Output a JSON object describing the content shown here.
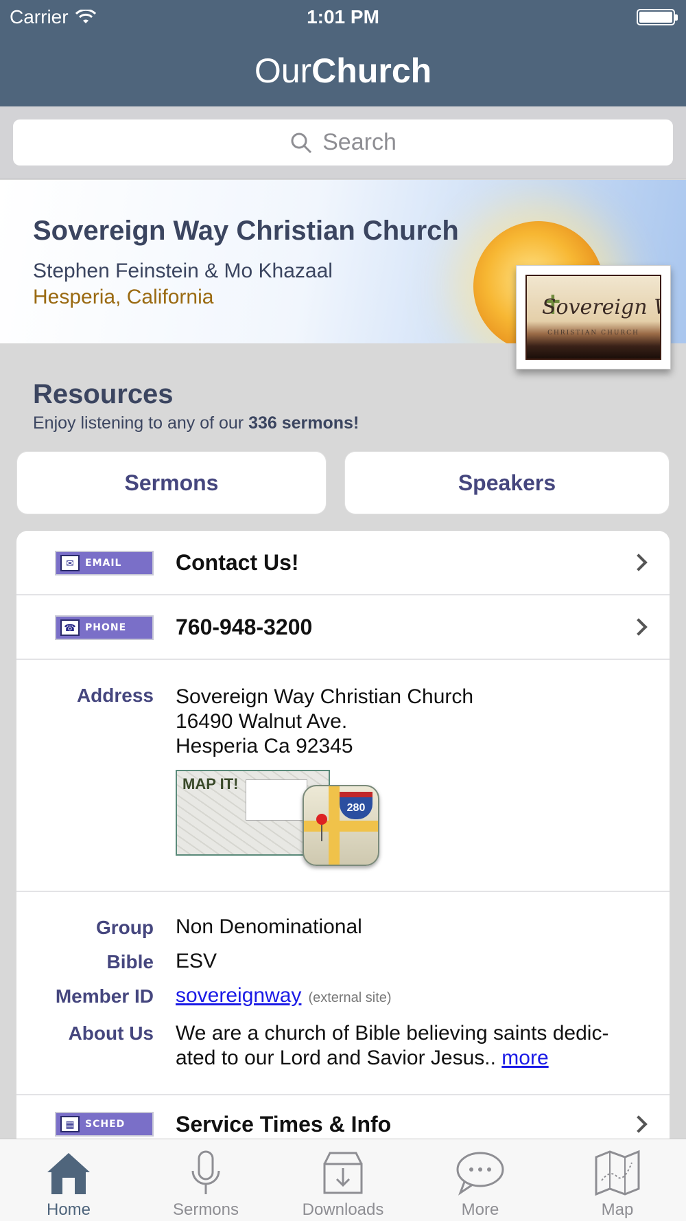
{
  "status_bar": {
    "carrier": "Carrier",
    "time": "1:01 PM"
  },
  "navbar": {
    "title_light": "Our",
    "title_bold": "Church"
  },
  "search": {
    "placeholder": "Search"
  },
  "church": {
    "name": "Sovereign Way Christian Church",
    "pastors": "Stephen Feinstein & Mo Khazaal",
    "location": "Hesperia, California",
    "logo_text": "Sovereign Way",
    "logo_subtext": "CHRISTIAN CHURCH"
  },
  "resources": {
    "title": "Resources",
    "subtitle_prefix": "Enjoy listening to any of our ",
    "subtitle_bold": "336 sermons!",
    "sermons_button": "Sermons",
    "speakers_button": "Speakers"
  },
  "contact": {
    "email_tag": "EMAIL",
    "email_label": "Contact Us!",
    "phone_tag": "PHONE",
    "phone_number": "760-948-3200"
  },
  "address": {
    "label": "Address",
    "line1": "Sovereign Way Christian Church",
    "line2": "16490 Walnut Ave.",
    "line3": "Hesperia Ca 92345",
    "map_it": "MAP IT!",
    "shield_number": "280"
  },
  "details": {
    "group_label": "Group",
    "group_value": "Non Denominational",
    "bible_label": "Bible",
    "bible_value": "ESV",
    "member_label": "Member ID",
    "member_value": "sovereignway",
    "member_external": "(external site)",
    "about_label": "About Us",
    "about_line1": "We are a church of Bible believing saints dedic-",
    "about_line2": "ated to our Lord and Savior Jesus.. ",
    "about_more": "more"
  },
  "sched": {
    "tag": "SCHED",
    "label": "Service Times & Info"
  },
  "tabbar": {
    "items": [
      {
        "label": "Home",
        "icon": "home-icon"
      },
      {
        "label": "Sermons",
        "icon": "microphone-icon"
      },
      {
        "label": "Downloads",
        "icon": "download-box-icon"
      },
      {
        "label": "More",
        "icon": "speech-bubble-icon"
      },
      {
        "label": "Map",
        "icon": "map-icon"
      }
    ]
  },
  "colors": {
    "navbar": "#4f657c",
    "accent_label": "#45467e",
    "location": "#9a6a12",
    "link": "#1a1ae6"
  }
}
